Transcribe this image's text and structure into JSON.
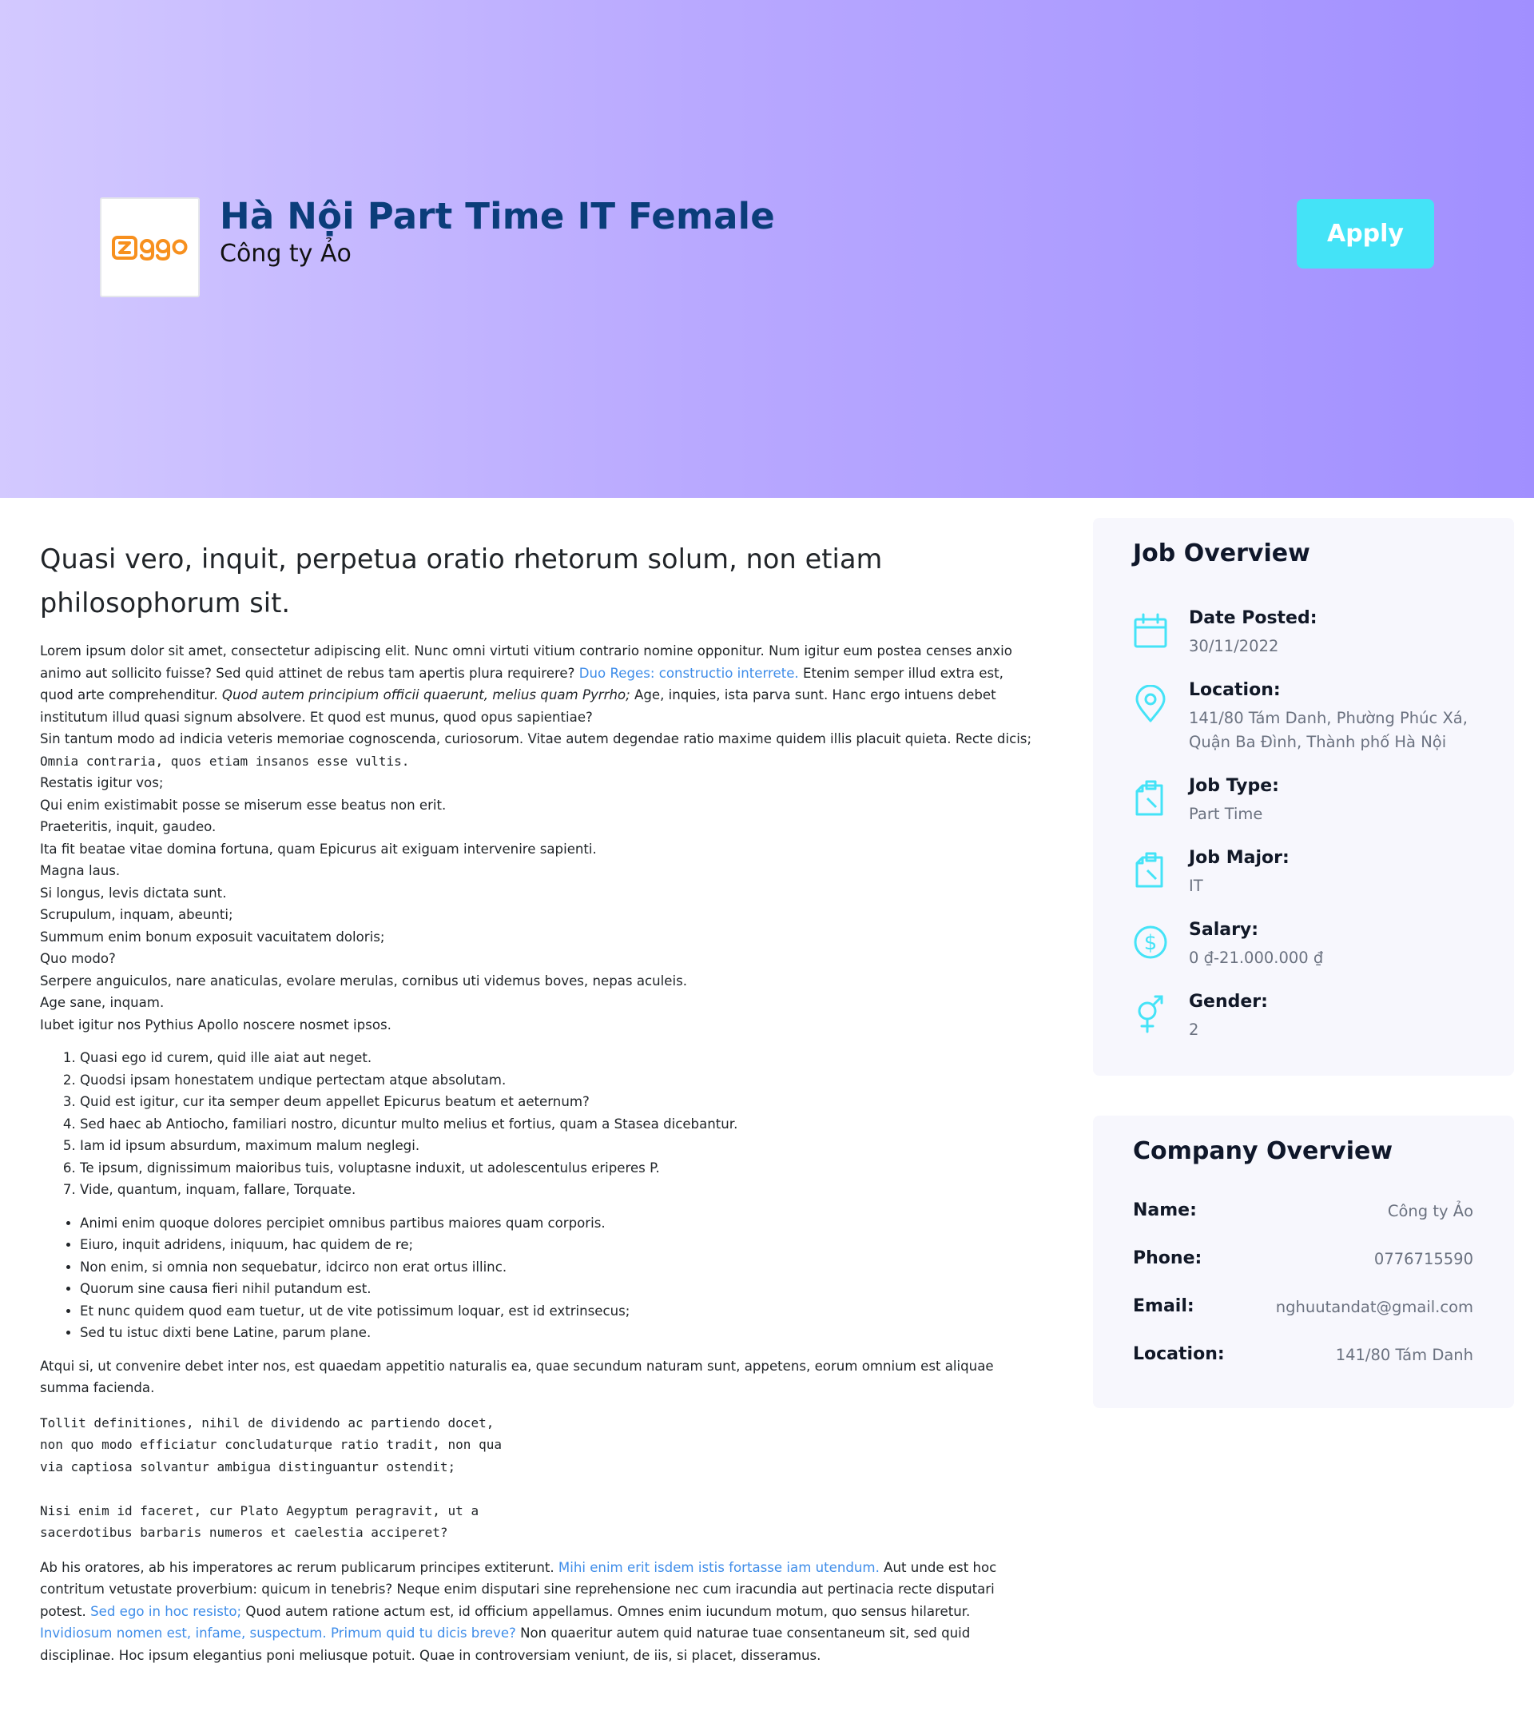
{
  "header": {
    "logo_text": "ziggo",
    "job_title": "Hà Nội Part Time IT Female",
    "company_name": "Công ty Ảo",
    "apply_label": "Apply"
  },
  "description": {
    "heading": "Quasi vero, inquit, perpetua oratio rhetorum solum, non etiam philosophorum sit.",
    "p1_a": "Lorem ipsum dolor sit amet, consectetur adipiscing elit. Nunc omni virtuti vitium contrario nomine opponitur. Num igitur eum postea censes anxio animo aut sollicito fuisse? Sed quid attinet de rebus tam apertis plura requirere? ",
    "p1_link": "Duo Reges: constructio interrete.",
    "p1_b": " Etenim semper illud extra est, quod arte comprehenditur. ",
    "p1_em": "Quod autem principium officii quaerunt, melius quam Pyrrho;",
    "p1_c": " Age, inquies, ista parva sunt. Hanc ergo intuens debet institutum illud quasi signum absolvere. Et quod est munus, quod opus sapientiae?",
    "p2_a": "Sin tantum modo ad indicia veteris memoriae cognoscenda, curiosorum. Vitae autem degendae ratio maxime quidem illis placuit quieta. Recte dicis; ",
    "p2_code": "Omnia contraria, quos etiam insanos esse vultis.",
    "lines": [
      "Restatis igitur vos;",
      "Qui enim existimabit posse se miserum esse beatus non erit.",
      "Praeteritis, inquit, gaudeo.",
      "Ita fit beatae vitae domina fortuna, quam Epicurus ait exiguam intervenire sapienti.",
      "Magna laus.",
      "Si longus, levis dictata sunt.",
      "Scrupulum, inquam, abeunti;",
      "Summum enim bonum exposuit vacuitatem doloris;",
      "Quo modo?",
      "Serpere anguiculos, nare anaticulas, evolare merulas, cornibus uti videmus boves, nepas aculeis.",
      "Age sane, inquam.",
      "Iubet igitur nos Pythius Apollo noscere nosmet ipsos."
    ],
    "ordered": [
      "Quasi ego id curem, quid ille aiat aut neget.",
      "Quodsi ipsam honestatem undique pertectam atque absolutam.",
      "Quid est igitur, cur ita semper deum appellet Epicurus beatum et aeternum?",
      "Sed haec ab Antiocho, familiari nostro, dicuntur multo melius et fortius, quam a Stasea dicebantur.",
      "Iam id ipsum absurdum, maximum malum neglegi.",
      "Te ipsum, dignissimum maioribus tuis, voluptasne induxit, ut adolescentulus eriperes P.",
      "Vide, quantum, inquam, fallare, Torquate."
    ],
    "unordered": [
      "Animi enim quoque dolores percipiet omnibus partibus maiores quam corporis.",
      "Eiuro, inquit adridens, iniquum, hac quidem de re;",
      "Non enim, si omnia non sequebatur, idcirco non erat ortus illinc.",
      "Quorum sine causa fieri nihil putandum est.",
      "Et nunc quidem quod eam tuetur, ut de vite potissimum loquar, est id extrinsecus;",
      "Sed tu istuc dixti bene Latine, parum plane."
    ],
    "p3": "Atqui si, ut convenire debet inter nos, est quaedam appetitio naturalis ea, quae secundum naturam sunt, appetens, eorum omnium est aliquae summa facienda.",
    "pre": "Tollit definitiones, nihil de dividendo ac partiendo docet,\nnon quo modo efficiatur concludaturque ratio tradit, non qua\nvia captiosa solvantur ambigua distinguantur ostendit;\n\nNisi enim id faceret, cur Plato Aegyptum peragravit, ut a\nsacerdotibus barbaris numeros et caelestia acciperet?",
    "p4_a": "Ab his oratores, ab his imperatores ac rerum publicarum principes extiterunt. ",
    "p4_link1": "Mihi enim erit isdem istis fortasse iam utendum.",
    "p4_b": " Aut unde est hoc contritum vetustate proverbium: quicum in tenebris? Neque enim disputari sine reprehensione nec cum iracundia aut pertinacia recte disputari potest. ",
    "p4_link2": "Sed ego in hoc resisto;",
    "p4_c": " Quod autem ratione actum est, id officium appellamus. Omnes enim iucundum motum, quo sensus hilaretur. ",
    "p4_link3": "Invidiosum nomen est, infame, suspectum.",
    "p4_d": " ",
    "p4_link4": "Primum quid tu dicis breve?",
    "p4_e": " Non quaeritur autem quid naturae tuae consentaneum sit, sed quid disciplinae. Hoc ipsum elegantius poni meliusque potuit. Quae in controversiam veniunt, de iis, si placet, disseramus."
  },
  "job_overview": {
    "title": "Job Overview",
    "accent_color": "#44e3f7",
    "items": [
      {
        "icon": "calendar-icon",
        "label": "Date Posted:",
        "value": "30/11/2022"
      },
      {
        "icon": "location-pin-icon",
        "label": "Location:",
        "value": "141/80 Tám Danh, Phường Phúc Xá, Quận Ba Đình, Thành phố Hà Nội"
      },
      {
        "icon": "clipboard-icon",
        "label": "Job Type:",
        "value": "Part Time"
      },
      {
        "icon": "clipboard-icon",
        "label": "Job Major:",
        "value": "IT"
      },
      {
        "icon": "dollar-icon",
        "label": "Salary:",
        "value": "0 ₫-21.000.000 ₫"
      },
      {
        "icon": "gender-icon",
        "label": "Gender:",
        "value": "2"
      }
    ]
  },
  "company_overview": {
    "title": "Company Overview",
    "rows": [
      {
        "label": "Name:",
        "value": "Công ty Ảo"
      },
      {
        "label": "Phone:",
        "value": "0776715590"
      },
      {
        "label": "Email:",
        "value": "nghuutandat@gmail.com"
      },
      {
        "label": "Location:",
        "value": "141/80 Tám Danh"
      }
    ]
  }
}
